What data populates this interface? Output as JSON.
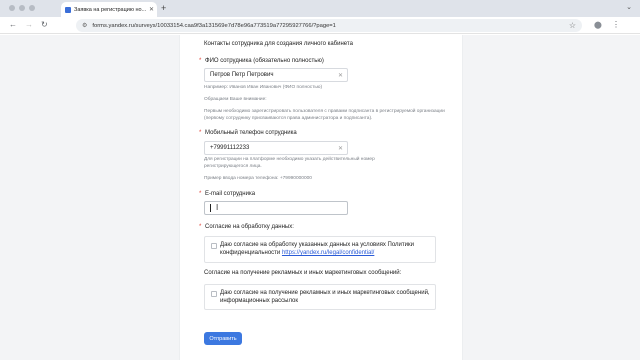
{
  "browser": {
    "tab_title": "Заявка на регистрацию но...",
    "tab_close": "✕",
    "new_tab": "+",
    "tabs_menu": "⌄",
    "url": "forms.yandex.ru/surveys/10033154.caa9f3a131569e7d78e96a773519a77295927766/?page=1",
    "back": "←",
    "forward": "→",
    "reload": "↻",
    "site_info": "⚙",
    "bookmark": "☆",
    "profile": "⬤",
    "menu": "⋮"
  },
  "form": {
    "section_title": "Контакты сотрудника для создания личного кабинета",
    "fio": {
      "label": "ФИО сотрудника (обязательно полностью)",
      "value": "Петров Петр Петрович",
      "clear": "✕",
      "hint1": "Например: Иванов Иван Иванович (ФИО полностью)",
      "hint2": "Обращаем Ваше внимание:",
      "hint3": "Первым необходимо зарегистрировать пользователя с правами подписанта в регистрируемой организации (первому сотруднику присваиваются права администратора и подписанта)."
    },
    "phone": {
      "label": "Мобильный телефон сотрудника",
      "value": "+79991112233",
      "clear": "✕",
      "hint1": "Для регистрации на платформе необходимо указать действительный номер регистрирующегося лица.",
      "hint2": "Пример ввода номера телефона: +79990000000"
    },
    "email": {
      "label": "E-mail сотрудника",
      "value": ""
    },
    "consent_data": {
      "label": "Согласие на обработку данных:",
      "text_before": "Даю согласие на обработку указанных данных на условиях Политики конфиденциальности ",
      "link": "https://yandex.ru/legal/confidential/"
    },
    "consent_ads": {
      "label": "Согласие на получение рекламных и иных маркетинговых сообщений:",
      "text": "Даю согласие на получение рекламных и иных маркетинговых сообщений, информационных рассылок"
    },
    "required_mark": "*",
    "submit_label": "Отправить"
  }
}
